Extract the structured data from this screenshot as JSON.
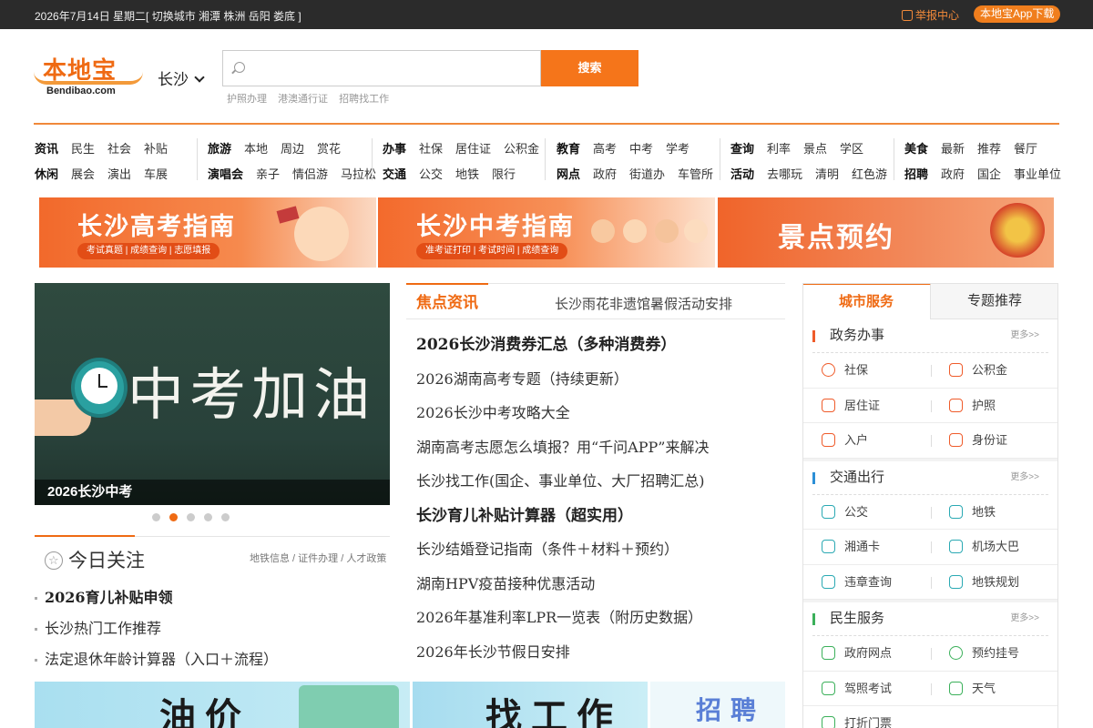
{
  "topbar": {
    "date": "2026年7月14日 星期二[ 切换城市 湘潭 株洲 岳阳 娄底 ]",
    "report": "举报中心",
    "app": "本地宝App下载"
  },
  "header": {
    "logo_main": "本地宝",
    "logo_sub": "Bendibao.com",
    "city": "长沙",
    "search_placeholder": "",
    "search_btn": "搜索",
    "hotwords": [
      "护照办理",
      "港澳通行证",
      "招聘找工作"
    ]
  },
  "nav": [
    {
      "rows": [
        [
          "资讯",
          "民生",
          "社会",
          "补贴"
        ],
        [
          "休闲",
          "展会",
          "演出",
          "车展"
        ]
      ]
    },
    {
      "rows": [
        [
          "旅游",
          "本地",
          "周边",
          "赏花"
        ],
        [
          "演唱会",
          "亲子",
          "情侣游",
          "马拉松"
        ]
      ]
    },
    {
      "rows": [
        [
          "办事",
          "社保",
          "居住证",
          "公积金"
        ],
        [
          "交通",
          "公交",
          "地铁",
          "限行"
        ]
      ]
    },
    {
      "rows": [
        [
          "教育",
          "高考",
          "中考",
          "学考"
        ],
        [
          "网点",
          "政府",
          "街道办",
          "车管所"
        ]
      ]
    },
    {
      "rows": [
        [
          "查询",
          "利率",
          "景点",
          "学区"
        ],
        [
          "活动",
          "去哪玩",
          "清明",
          "红色游"
        ]
      ]
    },
    {
      "rows": [
        [
          "美食",
          "最新",
          "推荐",
          "餐厅"
        ],
        [
          "招聘",
          "政府",
          "国企",
          "事业单位"
        ]
      ]
    }
  ],
  "banners": [
    {
      "title": "长沙高考指南",
      "sub": "考试真题 | 成绩查询 | 志愿填报"
    },
    {
      "title": "长沙中考指南",
      "sub": "准考证打印 | 考试时间 | 成绩查询"
    },
    {
      "title": "景点预约",
      "sub": ""
    }
  ],
  "hero": {
    "chalk": "中考加油",
    "caption": "2026长沙中考"
  },
  "today": {
    "title": "今日关注",
    "links": "地铁信息 / 证件办理 / 人才政策",
    "items": [
      "2026育儿补贴申领",
      "长沙热门工作推荐",
      "法定退休年龄计算器（入口＋流程）"
    ]
  },
  "news": {
    "tab": "焦点资讯",
    "marquee": "长沙雨花非遗馆暑假活动安排",
    "items": [
      "2026长沙消费券汇总（多种消费券）",
      "2026湖南高考专题（持续更新）",
      "2026长沙中考攻略大全",
      "湖南高考志愿怎么填报？用“千问APP”来解决",
      "长沙找工作(国企、事业单位、大厂招聘汇总)",
      "长沙育儿补贴计算器（超实用）",
      "长沙结婚登记指南（条件＋材料＋预约）",
      "湖南HPV疫苗接种优惠活动",
      "2026年基准利率LPR一览表（附历史数据）",
      "2026年长沙节假日安排"
    ]
  },
  "bottom_banners": [
    {
      "title": "油价"
    },
    {
      "title": "找工作"
    },
    {
      "title": "招聘"
    }
  ],
  "side": {
    "tab_active": "城市服务",
    "tab_other": "专题推荐",
    "sections": [
      {
        "title": "政务办事",
        "more": "更多>>",
        "rows": [
          [
            "社保",
            "公积金"
          ],
          [
            "居住证",
            "护照"
          ],
          [
            "入户",
            "身份证"
          ]
        ]
      },
      {
        "title": "交通出行",
        "more": "更多>>",
        "rows": [
          [
            "公交",
            "地铁"
          ],
          [
            "湘通卡",
            "机场大巴"
          ],
          [
            "违章查询",
            "地铁规划"
          ]
        ]
      },
      {
        "title": "民生服务",
        "more": "更多>>",
        "rows": [
          [
            "政府网点",
            "预约挂号"
          ],
          [
            "驾照考试",
            "天气"
          ],
          [
            "打折门票",
            ""
          ]
        ]
      }
    ]
  },
  "colors": {
    "accent": "#ef6a13",
    "topbar": "#2b2b2b"
  }
}
